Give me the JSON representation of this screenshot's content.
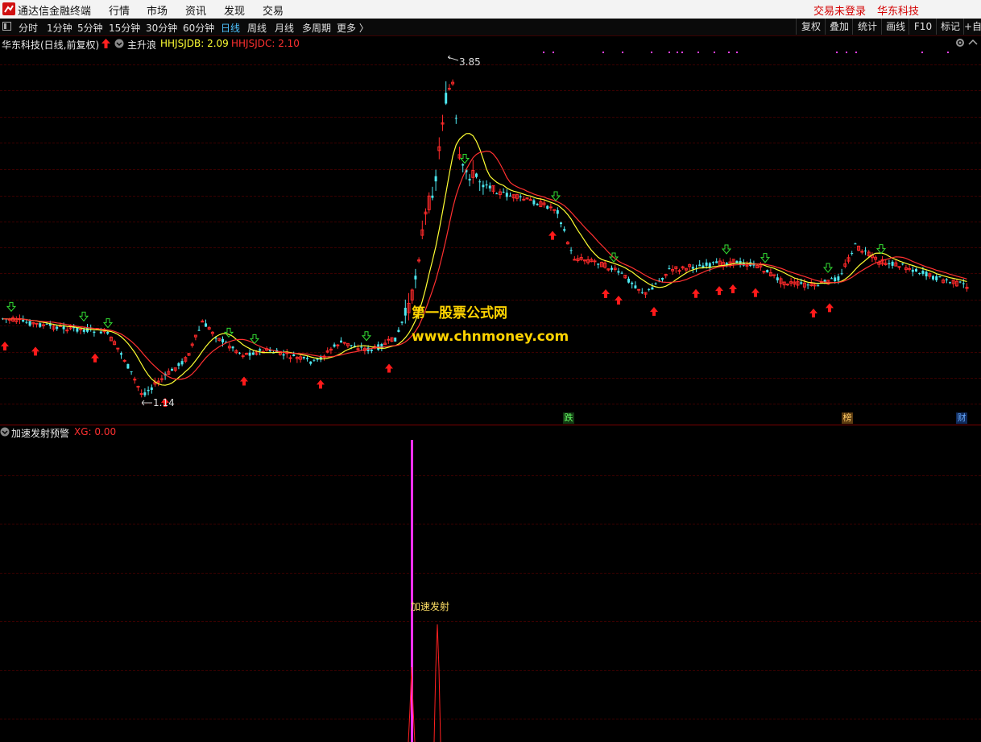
{
  "titlebar": {
    "app_title": "通达信金融终端",
    "menus": [
      "行情",
      "市场",
      "资讯",
      "发现",
      "交易"
    ],
    "login_status": "交易未登录",
    "account_name": "华东科技"
  },
  "toolbar": {
    "periods": [
      "分时",
      "1分钟",
      "5分钟",
      "15分钟",
      "30分钟",
      "60分钟",
      "日线",
      "周线",
      "月线",
      "多周期",
      "更多 〉"
    ],
    "active_period": "日线",
    "right_buttons": [
      "复权",
      "叠加",
      "统计",
      "画线",
      "F10",
      "标记",
      "+自"
    ]
  },
  "main_chart": {
    "stock_title": "华东科技(日线,前复权)",
    "indicator_name": "主升浪",
    "hhjsjdb_label": "HHJSJDB: 2.09",
    "hhjsjdc_label": "HHJSJDC: 2.10",
    "high_label": "3.85",
    "low_label": "1.14",
    "event_labels": [
      "跌",
      "榜",
      "财"
    ],
    "colors": {
      "up": "#ff2a2a",
      "down": "#4de8f0",
      "ma_fast": "#ffff33",
      "ma_slow": "#ff3030",
      "buy": "#ff1a1a",
      "sell": "#33dd33"
    }
  },
  "watermark": {
    "line1": "第一股票公式网",
    "line2": "www.chnmoney.com"
  },
  "sub_chart": {
    "indicator_name": "加速发射预警",
    "xg_label": "XG: 0.00",
    "signal_label": "加速发射",
    "colors": {
      "signal": "#ff30ff",
      "bar": "#ff2020"
    }
  }
}
